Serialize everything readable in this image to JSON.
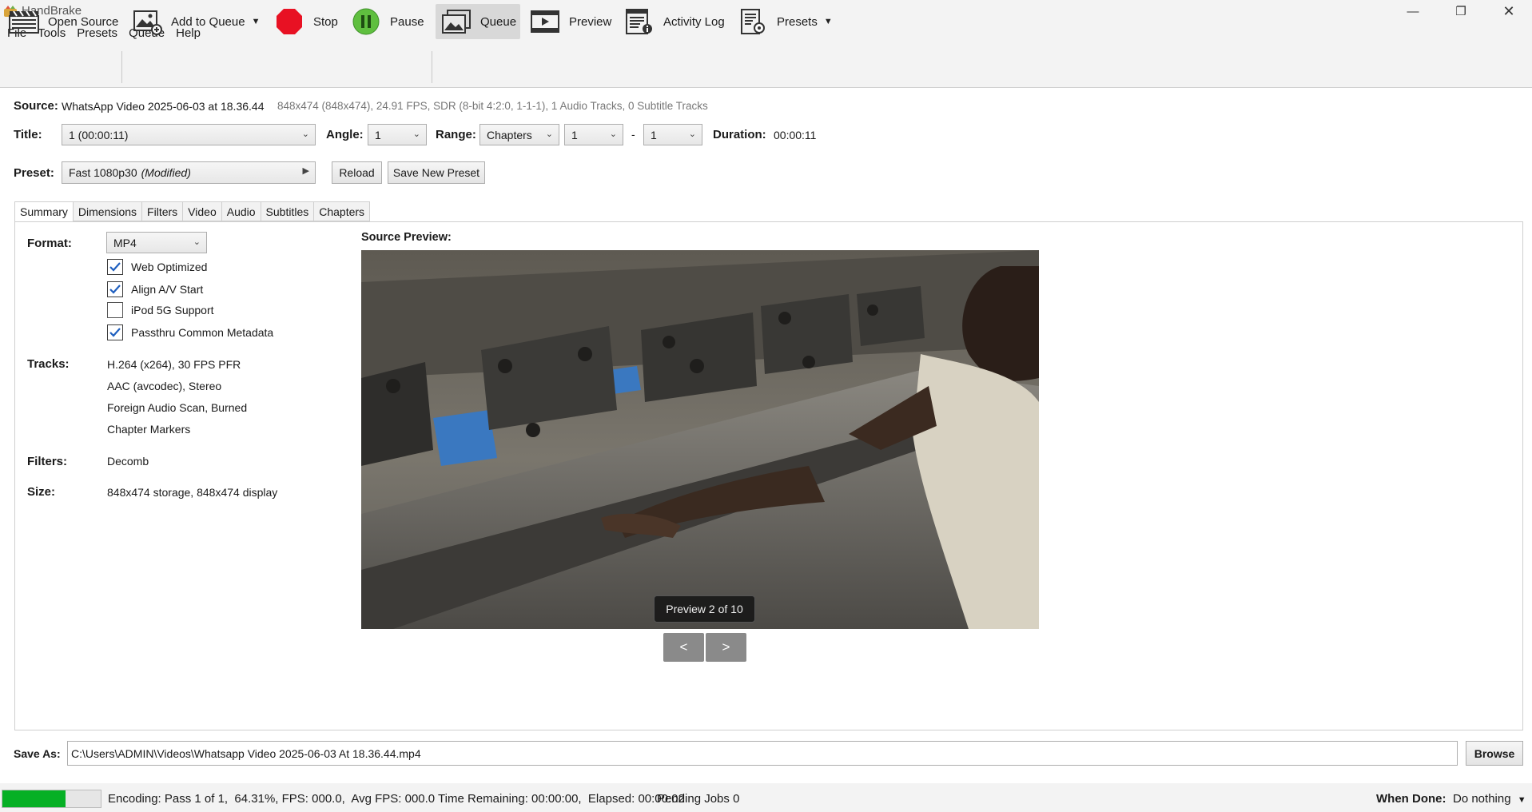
{
  "window": {
    "title": "HandBrake"
  },
  "menu": [
    "File",
    "Tools",
    "Presets",
    "Queue",
    "Help"
  ],
  "toolbar": {
    "open_source": "Open Source",
    "add_to_queue": "Add to Queue",
    "stop": "Stop",
    "pause": "Pause",
    "queue": "Queue",
    "preview": "Preview",
    "activity_log": "Activity Log",
    "presets": "Presets"
  },
  "source": {
    "label": "Source:",
    "name": "WhatsApp Video 2025-06-03 at 18.36.44",
    "details": "848x474 (848x474), 24.91 FPS, SDR (8-bit 4:2:0, 1-1-1), 1 Audio Tracks, 0 Subtitle Tracks"
  },
  "title_row": {
    "title_label": "Title:",
    "title_value": "1  (00:00:11)",
    "angle_label": "Angle:",
    "angle_value": "1",
    "range_label": "Range:",
    "range_mode": "Chapters",
    "range_start": "1",
    "range_dash": "-",
    "range_end": "1",
    "duration_label": "Duration:",
    "duration_value": "00:00:11"
  },
  "preset_row": {
    "label": "Preset:",
    "name": "Fast 1080p30",
    "modified": "(Modified)",
    "reload": "Reload",
    "save_new": "Save New Preset"
  },
  "tabs": [
    "Summary",
    "Dimensions",
    "Filters",
    "Video",
    "Audio",
    "Subtitles",
    "Chapters"
  ],
  "summary": {
    "format_label": "Format:",
    "format_value": "MP4",
    "options": [
      {
        "label": "Web Optimized",
        "checked": true
      },
      {
        "label": "Align A/V Start",
        "checked": true
      },
      {
        "label": "iPod 5G Support",
        "checked": false
      },
      {
        "label": "Passthru Common Metadata",
        "checked": true
      }
    ],
    "tracks_label": "Tracks:",
    "tracks": [
      "H.264 (x264), 30 FPS PFR",
      "AAC (avcodec), Stereo",
      "Foreign Audio Scan, Burned",
      "Chapter Markers"
    ],
    "filters_label": "Filters:",
    "filters_value": "Decomb",
    "size_label": "Size:",
    "size_value": "848x474 storage, 848x474 display"
  },
  "preview": {
    "label": "Source Preview:",
    "badge": "Preview 2 of 10",
    "prev": "<",
    "next": ">"
  },
  "save_as": {
    "label": "Save As:",
    "path": "C:\\Users\\ADMIN\\Videos\\Whatsapp Video 2025-06-03 At 18.36.44.mp4",
    "browse": "Browse"
  },
  "status": {
    "progress_percent": 64.31,
    "text": "Encoding: Pass 1 of 1,  64.31%, FPS: 000.0,  Avg FPS: 000.0 Time Remaining: 00:00:00,  Elapsed: 00:00:02",
    "pending": "Pending Jobs 0",
    "when_done_label": "When Done:",
    "when_done_value": "Do nothing"
  },
  "colors": {
    "progress": "#06b025",
    "stop": "#e81123",
    "pause": "#5fbf3f"
  }
}
